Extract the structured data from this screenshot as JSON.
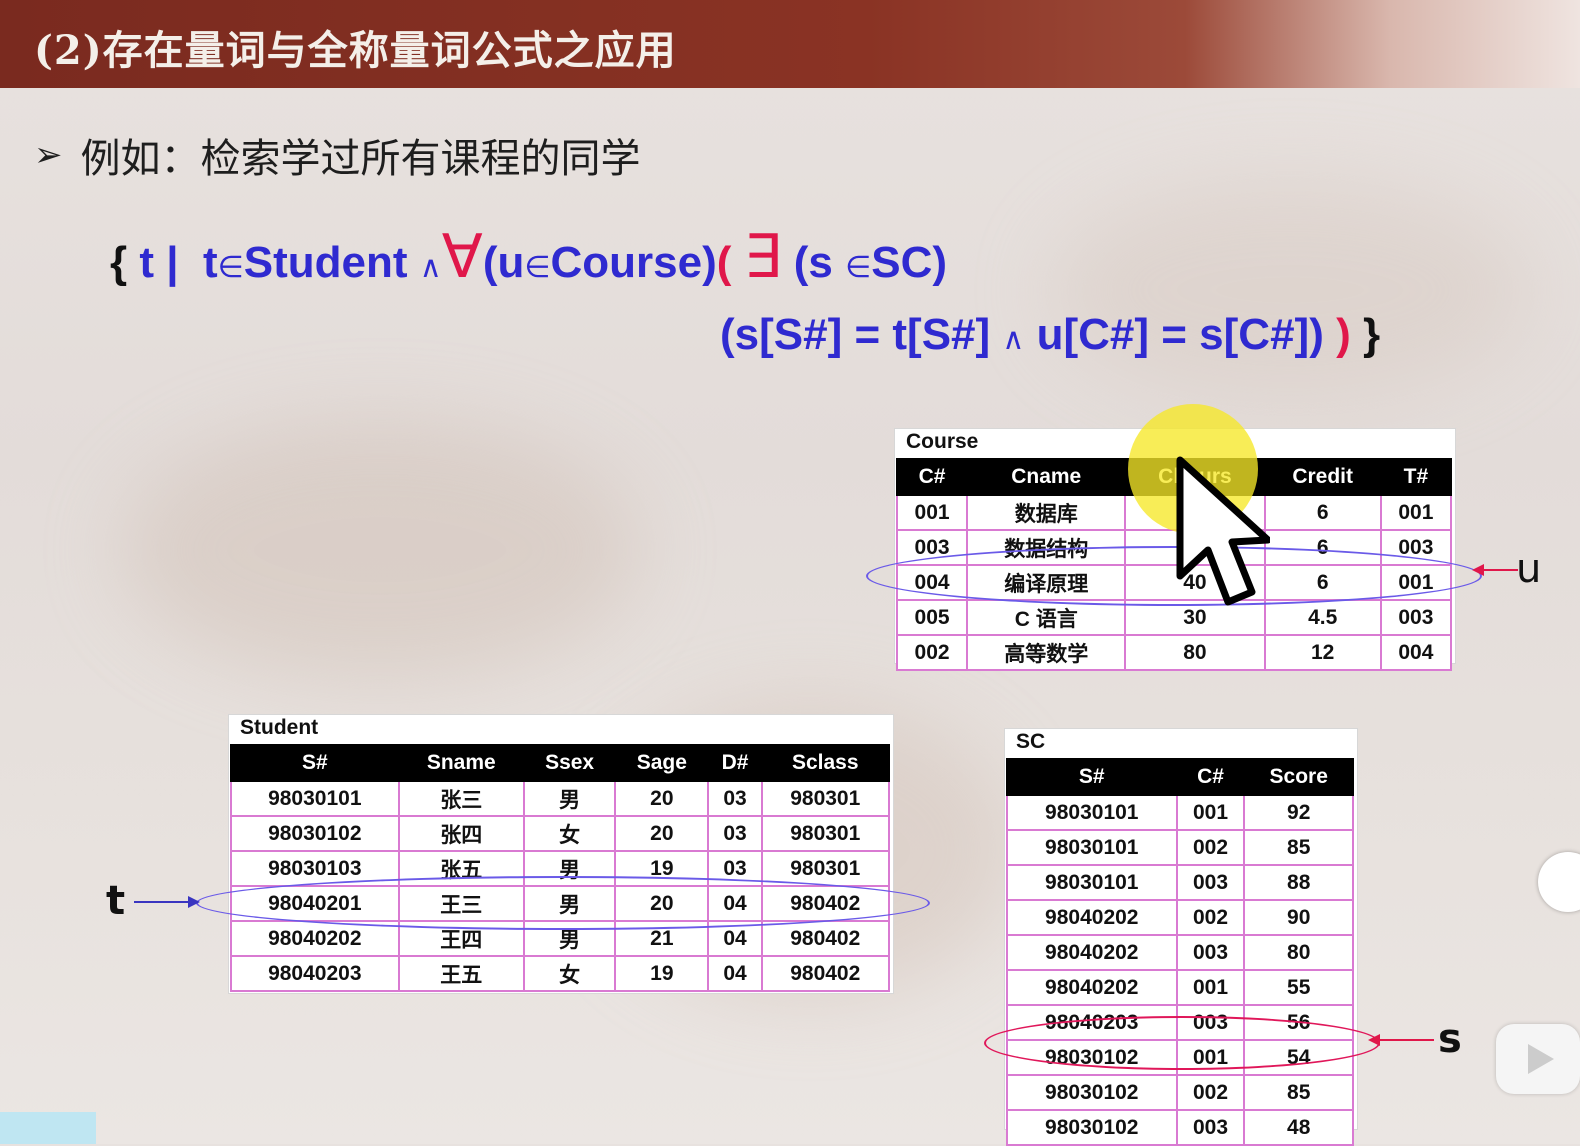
{
  "slide": {
    "title": "(2)存在量词与全称量词公式之应用",
    "bullet_marker": "➢",
    "bullet_text": "例如：检索学过所有课程的同学"
  },
  "formula": {
    "line1": {
      "open_brace": "{",
      "t_bar": "t |",
      "t_in": "t",
      "elem1": "∈",
      "student": "Student",
      "and1": "∧",
      "forall": "∀",
      "u_part_open": "(u",
      "elem2": "∈",
      "course": "Course)",
      "paren_red_open": "(",
      "exists": "∃",
      "s_part_open": "(s",
      "elem3": "∈",
      "sc": "SC)"
    },
    "line2": {
      "cond_left": "(s[S#] = t[S#]",
      "and2": "∧",
      "cond_right": "u[C#] = s[C#])",
      "paren_red_close": ")",
      "close_brace": "}"
    }
  },
  "course_table": {
    "caption": "Course",
    "headers": [
      "C#",
      "Cname",
      "Chours",
      "Credit",
      "T#"
    ],
    "rows": [
      [
        "001",
        "数据库",
        "40",
        "6",
        "001"
      ],
      [
        "003",
        "数据结构",
        "40",
        "6",
        "003"
      ],
      [
        "004",
        "编译原理",
        "40",
        "6",
        "001"
      ],
      [
        "005",
        "C 语言",
        "30",
        "4.5",
        "003"
      ],
      [
        "002",
        "高等数学",
        "80",
        "12",
        "004"
      ]
    ]
  },
  "student_table": {
    "caption": "Student",
    "headers": [
      "S#",
      "Sname",
      "Ssex",
      "Sage",
      "D#",
      "Sclass"
    ],
    "rows": [
      [
        "98030101",
        "张三",
        "男",
        "20",
        "03",
        "980301"
      ],
      [
        "98030102",
        "张四",
        "女",
        "20",
        "03",
        "980301"
      ],
      [
        "98030103",
        "张五",
        "男",
        "19",
        "03",
        "980301"
      ],
      [
        "98040201",
        "王三",
        "男",
        "20",
        "04",
        "980402"
      ],
      [
        "98040202",
        "王四",
        "男",
        "21",
        "04",
        "980402"
      ],
      [
        "98040203",
        "王五",
        "女",
        "19",
        "04",
        "980402"
      ]
    ]
  },
  "sc_table": {
    "caption": "SC",
    "headers": [
      "S#",
      "C#",
      "Score"
    ],
    "rows": [
      [
        "98030101",
        "001",
        "92"
      ],
      [
        "98030101",
        "002",
        "85"
      ],
      [
        "98030101",
        "003",
        "88"
      ],
      [
        "98040202",
        "002",
        "90"
      ],
      [
        "98040202",
        "003",
        "80"
      ],
      [
        "98040202",
        "001",
        "55"
      ],
      [
        "98040203",
        "003",
        "56"
      ],
      [
        "98030102",
        "001",
        "54"
      ],
      [
        "98030102",
        "002",
        "85"
      ],
      [
        "98030102",
        "003",
        "48"
      ]
    ]
  },
  "labels": {
    "u": "u",
    "t": "t",
    "s": "s"
  },
  "colors": {
    "header_bg": "#7a2a1f",
    "formula_blue": "#2f2ad0",
    "formula_red": "#e0174a",
    "ellipse_blue": "#6a5ae8",
    "ellipse_red": "#e0175a",
    "cell_border": "#d97ad2"
  },
  "icons": {
    "cursor": "mouse-pointer-icon",
    "side_button": "circle-button-icon",
    "play": "play-button-icon"
  }
}
